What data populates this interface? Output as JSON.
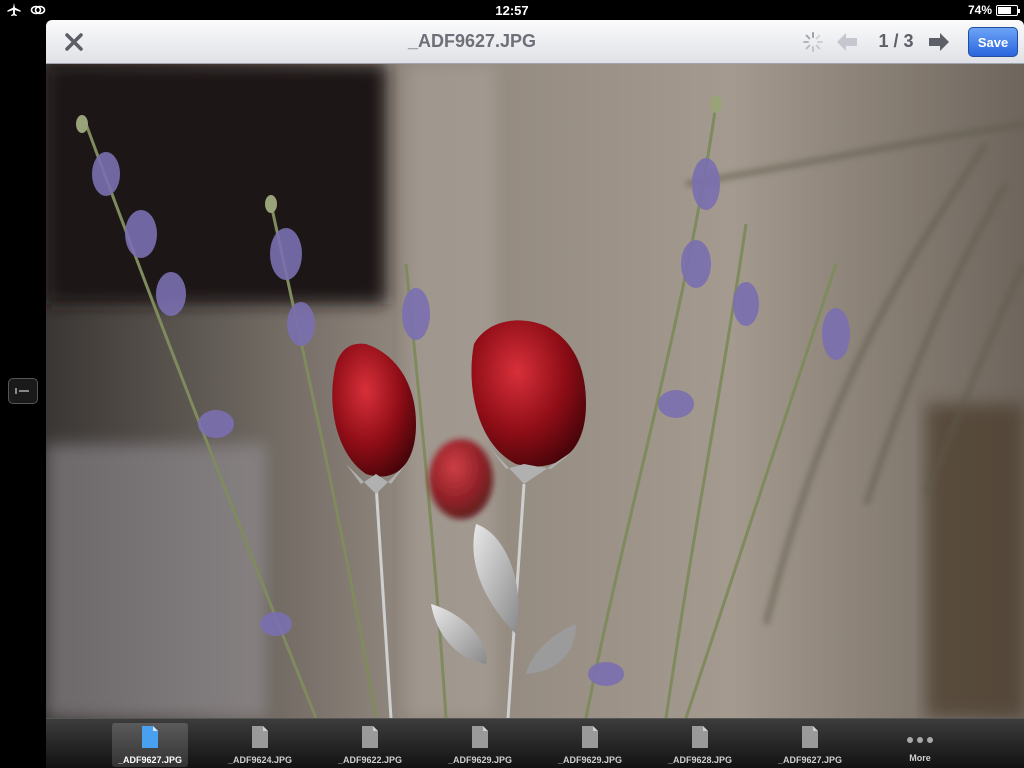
{
  "status_bar": {
    "time": "12:57",
    "battery": "74%",
    "battery_level": 0.74,
    "icons": [
      "airplane-icon",
      "sync-icon"
    ]
  },
  "viewer": {
    "title": "_ADF9627.JPG",
    "counter": "1 / 3",
    "save_label": "Save",
    "accent": "#2a66dd",
    "photo": {
      "bg": "#7d756e"
    }
  },
  "files": [
    {
      "label": "_ADF9627.JPG",
      "selected": true
    },
    {
      "label": "_ADF9624.JPG",
      "selected": false
    },
    {
      "label": "_ADF9622.JPG",
      "selected": false
    },
    {
      "label": "_ADF9629.JPG",
      "selected": false
    },
    {
      "label": "_ADF9629.JPG",
      "selected": false
    },
    {
      "label": "_ADF9628.JPG",
      "selected": false
    },
    {
      "label": "_ADF9627.JPG",
      "selected": false
    }
  ],
  "more_label": "More"
}
